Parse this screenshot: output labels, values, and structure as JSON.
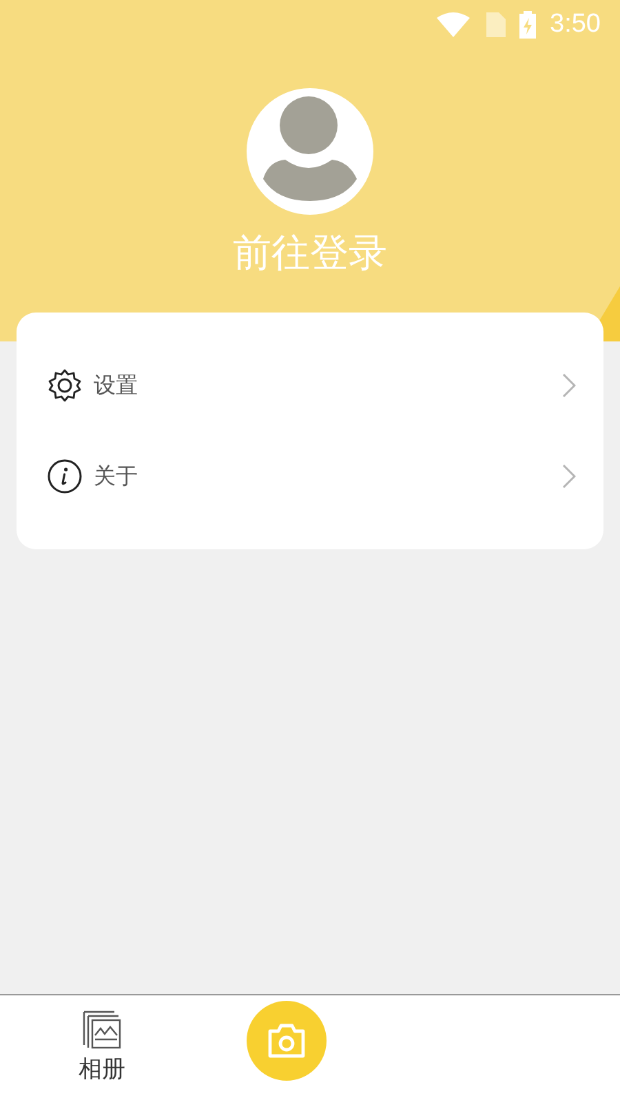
{
  "status_bar": {
    "time": "3:50"
  },
  "profile": {
    "title": "前往登录"
  },
  "menu": [
    {
      "label": "设置",
      "kind": "settings"
    },
    {
      "label": "关于",
      "kind": "about"
    }
  ],
  "bottom_nav": [
    {
      "kind": "album",
      "label": "相册"
    },
    {
      "kind": "camera"
    }
  ]
}
